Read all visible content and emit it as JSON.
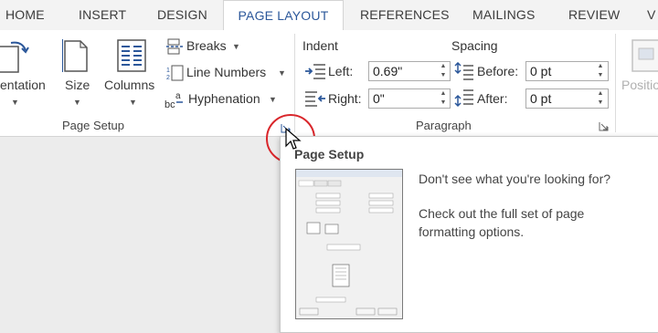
{
  "tabs": [
    {
      "label": "HOME"
    },
    {
      "label": "INSERT"
    },
    {
      "label": "DESIGN"
    },
    {
      "label": "PAGE LAYOUT"
    },
    {
      "label": "REFERENCES"
    },
    {
      "label": "MAILINGS"
    },
    {
      "label": "REVIEW"
    },
    {
      "label": "V"
    }
  ],
  "page_setup": {
    "orientation_label": "entation",
    "size_label": "Size",
    "columns_label": "Columns",
    "breaks_label": "Breaks",
    "line_numbers_label": "Line Numbers",
    "hyphenation_label": "Hyphenation",
    "group_label": "Page Setup"
  },
  "paragraph": {
    "indent_heading": "Indent",
    "spacing_heading": "Spacing",
    "left_label": "Left:",
    "left_value": "0.69\"",
    "right_label": "Right:",
    "right_value": "0\"",
    "before_label": "Before:",
    "before_value": "0 pt",
    "after_label": "After:",
    "after_value": "0 pt",
    "group_label": "Paragraph"
  },
  "arrange": {
    "position_label": "Positio"
  },
  "tooltip": {
    "title": "Page Setup",
    "line1": "Don't see what you're looking for?",
    "line2": "Check out the full set of page",
    "line3": "formatting options."
  },
  "colors": {
    "accent": "#2b579a",
    "highlight_circle": "#d9262b"
  }
}
